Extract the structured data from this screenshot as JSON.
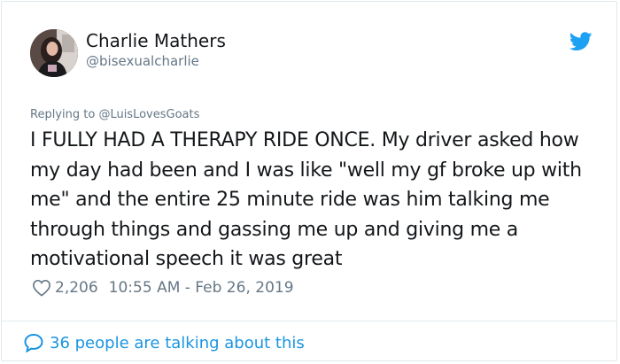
{
  "tweet": {
    "author": {
      "name": "Charlie Mathers",
      "handle": "@bisexualcharlie",
      "avatar_icon": "profile-photo"
    },
    "platform_icon": "twitter-bird-icon",
    "replying_prefix": "Replying to",
    "replying_to": "@LuisLovesGoats",
    "text": "I FULLY HAD A THERAPY RIDE ONCE. My driver asked how my day had been and I was like \"well my gf broke up with me\" and the entire 25 minute ride was him talking me through things and gassing me up and giving me a motivational speech it was great",
    "likes": "2,206",
    "timestamp": "10:55 AM - Feb 26, 2019",
    "conversation": "36 people are talking about this"
  },
  "colors": {
    "text": "#14171a",
    "secondary": "#657786",
    "accent": "#1b95e0",
    "border": "#e1e8ed"
  }
}
